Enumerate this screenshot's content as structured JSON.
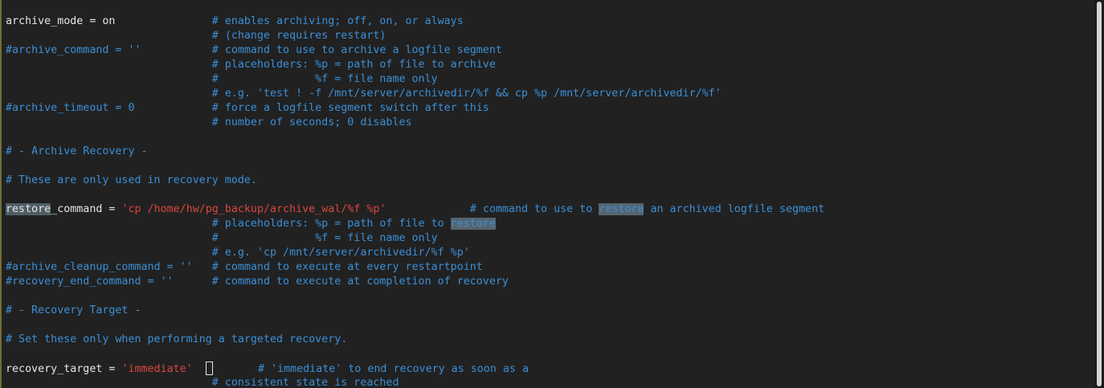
{
  "editor": {
    "lines": [
      {
        "name": "line-archive-mode",
        "parts": [
          {
            "cls": "plain",
            "text": "archive_mode = on               "
          },
          {
            "cls": "cmt",
            "text": "# enables archiving; off, on, or always"
          }
        ]
      },
      {
        "name": "line-archive-mode-note",
        "parts": [
          {
            "cls": "cmt",
            "text": "                                # (change requires restart)"
          }
        ]
      },
      {
        "name": "line-archive-command",
        "parts": [
          {
            "cls": "cmt",
            "text": "#archive_command = ''           # command to use to archive a logfile segment"
          }
        ]
      },
      {
        "name": "line-archive-placeholders",
        "parts": [
          {
            "cls": "cmt",
            "text": "                                # placeholders: %p = path of file to archive"
          }
        ]
      },
      {
        "name": "line-archive-placeholder-f",
        "parts": [
          {
            "cls": "cmt",
            "text": "                                #               %f = file name only"
          }
        ]
      },
      {
        "name": "line-archive-example",
        "parts": [
          {
            "cls": "cmt",
            "text": "                                # e.g. 'test ! -f /mnt/server/archivedir/%f && cp %p /mnt/server/archivedir/%f'"
          }
        ]
      },
      {
        "name": "line-archive-timeout",
        "parts": [
          {
            "cls": "cmt",
            "text": "#archive_timeout = 0            # force a logfile segment switch after this"
          }
        ]
      },
      {
        "name": "line-archive-timeout-note",
        "parts": [
          {
            "cls": "cmt",
            "text": "                                # number of seconds; 0 disables"
          }
        ]
      },
      {
        "name": "line-blank-1",
        "parts": [
          {
            "cls": "plain",
            "text": " "
          }
        ]
      },
      {
        "name": "line-archive-recovery-header",
        "parts": [
          {
            "cls": "cmt",
            "text": "# - Archive Recovery -"
          }
        ]
      },
      {
        "name": "line-blank-2",
        "parts": [
          {
            "cls": "plain",
            "text": " "
          }
        ]
      },
      {
        "name": "line-recovery-mode-note",
        "parts": [
          {
            "cls": "cmt",
            "text": "# These are only used in recovery mode."
          }
        ]
      },
      {
        "name": "line-blank-3",
        "parts": [
          {
            "cls": "plain",
            "text": " "
          }
        ]
      },
      {
        "name": "line-restore-command",
        "parts": [
          {
            "cls": "hl-first",
            "text": "restore"
          },
          {
            "cls": "plain",
            "text": "_command = "
          },
          {
            "cls": "str",
            "text": "'cp /home/hw/pg_backup/archive_wal/%f %p'"
          },
          {
            "cls": "plain",
            "text": "             "
          },
          {
            "cls": "cmt",
            "text": "# command to use to "
          },
          {
            "cls": "hl-search",
            "text": "restore"
          },
          {
            "cls": "cmt",
            "text": " an archived logfile segment"
          }
        ]
      },
      {
        "name": "line-restore-placeholders",
        "parts": [
          {
            "cls": "cmt",
            "text": "                                # placeholders: %p = path of file to "
          },
          {
            "cls": "hl-search",
            "text": "restore"
          }
        ]
      },
      {
        "name": "line-restore-placeholder-f",
        "parts": [
          {
            "cls": "cmt",
            "text": "                                #               %f = file name only"
          }
        ]
      },
      {
        "name": "line-restore-example",
        "parts": [
          {
            "cls": "cmt",
            "text": "                                # e.g. 'cp /mnt/server/archivedir/%f %p'"
          }
        ]
      },
      {
        "name": "line-archive-cleanup-command",
        "parts": [
          {
            "cls": "cmt",
            "text": "#archive_cleanup_command = ''   # command to execute at every restartpoint"
          }
        ]
      },
      {
        "name": "line-recovery-end-command",
        "parts": [
          {
            "cls": "cmt",
            "text": "#recovery_end_command = ''      # command to execute at completion of recovery"
          }
        ]
      },
      {
        "name": "line-blank-4",
        "parts": [
          {
            "cls": "plain",
            "text": " "
          }
        ]
      },
      {
        "name": "line-recovery-target-header",
        "parts": [
          {
            "cls": "cmt",
            "text": "# - Recovery Target -"
          }
        ]
      },
      {
        "name": "line-blank-5",
        "parts": [
          {
            "cls": "plain",
            "text": " "
          }
        ]
      },
      {
        "name": "line-targeted-recovery-note",
        "parts": [
          {
            "cls": "cmt",
            "text": "# Set these only when performing a targeted recovery."
          }
        ]
      },
      {
        "name": "line-blank-6",
        "parts": [
          {
            "cls": "plain",
            "text": " "
          }
        ]
      },
      {
        "name": "line-recovery-target",
        "parts": [
          {
            "cls": "plain",
            "text": "recovery_target = "
          },
          {
            "cls": "str",
            "text": "'immediate'"
          },
          {
            "cls": "plain",
            "text": "  "
          },
          {
            "cls": "cursor",
            "text": ""
          },
          {
            "cls": "plain",
            "text": "       "
          },
          {
            "cls": "cmt",
            "text": "# 'immediate' to end recovery as soon as a"
          }
        ]
      },
      {
        "name": "line-consistent-state",
        "parts": [
          {
            "cls": "cmt",
            "text": "                                # consistent state is reached"
          }
        ]
      }
    ]
  }
}
